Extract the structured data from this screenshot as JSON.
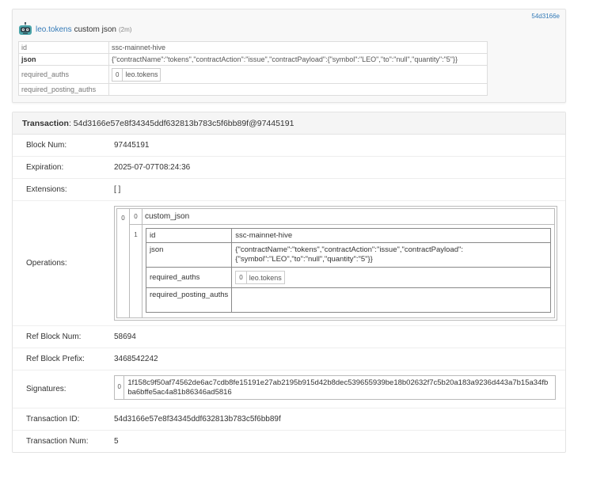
{
  "op_card": {
    "trx_short": "54d3166e",
    "account": "leo.tokens",
    "op_type": "custom json",
    "age": "(2m)",
    "rows": {
      "id_label": "id",
      "id_value": "ssc-mainnet-hive",
      "json_label": "json",
      "json_value": "{\"contractName\":\"tokens\",\"contractAction\":\"issue\",\"contractPayload\":{\"symbol\":\"LEO\",\"to\":\"null\",\"quantity\":\"5\"}}",
      "required_auths_label": "required_auths",
      "required_auths_index": "0",
      "required_auths_value": "leo.tokens",
      "required_posting_auths_label": "required_posting_auths"
    }
  },
  "transaction": {
    "header_label": "Transaction",
    "header_value": ": 54d3166e57e8f34345ddf632813b783c5f6bb89f@97445191",
    "block_num_label": "Block Num:",
    "block_num": "97445191",
    "expiration_label": "Expiration:",
    "expiration": "2025-07-07T08:24:36",
    "extensions_label": "Extensions:",
    "extensions": "[ ]",
    "operations_label": "Operations:",
    "operations": {
      "outer_index": "0",
      "type_index": "0",
      "type_name": "custom_json",
      "payload_index": "1",
      "id_label": "id",
      "id_value": "ssc-mainnet-hive",
      "json_label": "json",
      "json_value": "{\"contractName\":\"tokens\",\"contractAction\":\"issue\",\"contractPayload\":{\"symbol\":\"LEO\",\"to\":\"null\",\"quantity\":\"5\"}}",
      "required_auths_label": "required_auths",
      "required_auths_index": "0",
      "required_auths_value": "leo.tokens",
      "required_posting_auths_label": "required_posting_auths"
    },
    "ref_block_num_label": "Ref Block Num:",
    "ref_block_num": "58694",
    "ref_block_prefix_label": "Ref Block Prefix:",
    "ref_block_prefix": "3468542242",
    "signatures_label": "Signatures:",
    "signature_index": "0",
    "signature": "1f158c9f50af74562de6ac7cdb8fe15191e27ab2195b915d42b8dec539655939be18b02632f7c5b20a183a9236d443a7b15a34fbba6bffe5ac4a81b86346ad5816",
    "transaction_id_label": "Transaction ID:",
    "transaction_id": "54d3166e57e8f34345ddf632813b783c5f6bb89f",
    "transaction_num_label": "Transaction Num:",
    "transaction_num": "5"
  }
}
